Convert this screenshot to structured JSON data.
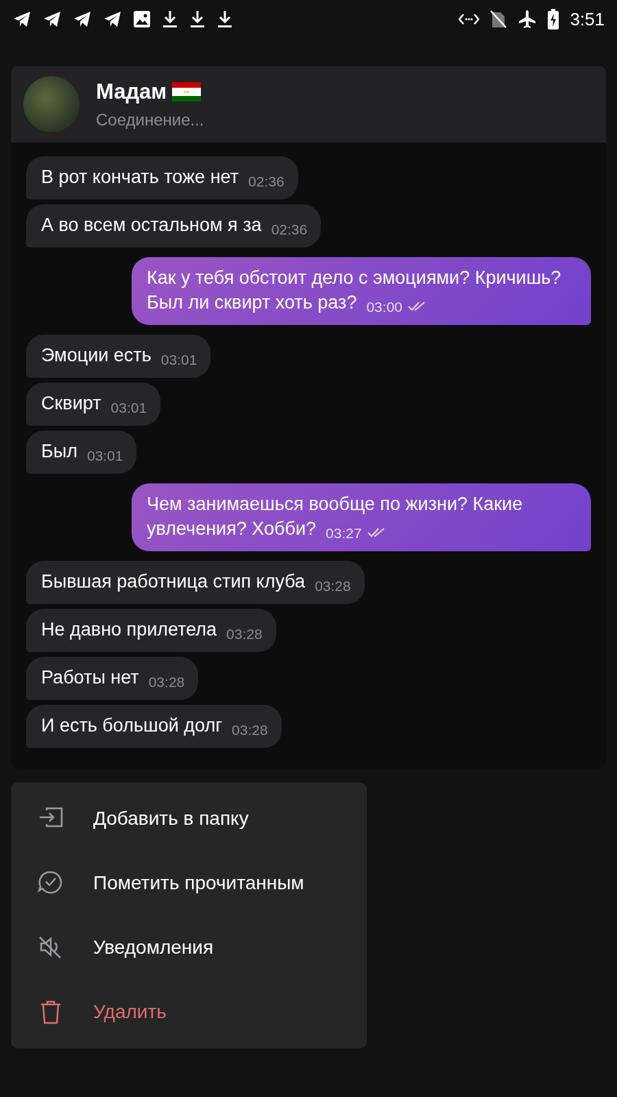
{
  "status_bar": {
    "time": "3:51"
  },
  "chat": {
    "name": "Мадам",
    "status": "Соединение...",
    "messages": [
      {
        "text": "В рот кончать тоже нет",
        "time": "02:36",
        "outgoing": false
      },
      {
        "text": "А во всем остальном я за",
        "time": "02:36",
        "outgoing": false
      },
      {
        "text": "Как у тебя обстоит дело с эмоциями? Кричишь? Был ли сквирт хоть раз?",
        "time": "03:00",
        "outgoing": true,
        "read": true
      },
      {
        "text": "Эмоции есть",
        "time": "03:01",
        "outgoing": false
      },
      {
        "text": "Сквирт",
        "time": "03:01",
        "outgoing": false
      },
      {
        "text": "Был",
        "time": "03:01",
        "outgoing": false
      },
      {
        "text": "Чем занимаешься вообще по жизни? Какие увлечения? Хобби?",
        "time": "03:27",
        "outgoing": true,
        "read": true
      },
      {
        "text": "Бывшая работница стип клуба",
        "time": "03:28",
        "outgoing": false
      },
      {
        "text": "Не давно прилетела",
        "time": "03:28",
        "outgoing": false
      },
      {
        "text": "Работы нет",
        "time": "03:28",
        "outgoing": false
      },
      {
        "text": "И есть большой долг",
        "time": "03:28",
        "outgoing": false
      }
    ]
  },
  "menu": [
    {
      "label": "Добавить в папку",
      "kind": "folder"
    },
    {
      "label": "Пометить прочитанным",
      "kind": "read"
    },
    {
      "label": "Уведомления",
      "kind": "mute"
    },
    {
      "label": "Удалить",
      "kind": "delete"
    }
  ]
}
